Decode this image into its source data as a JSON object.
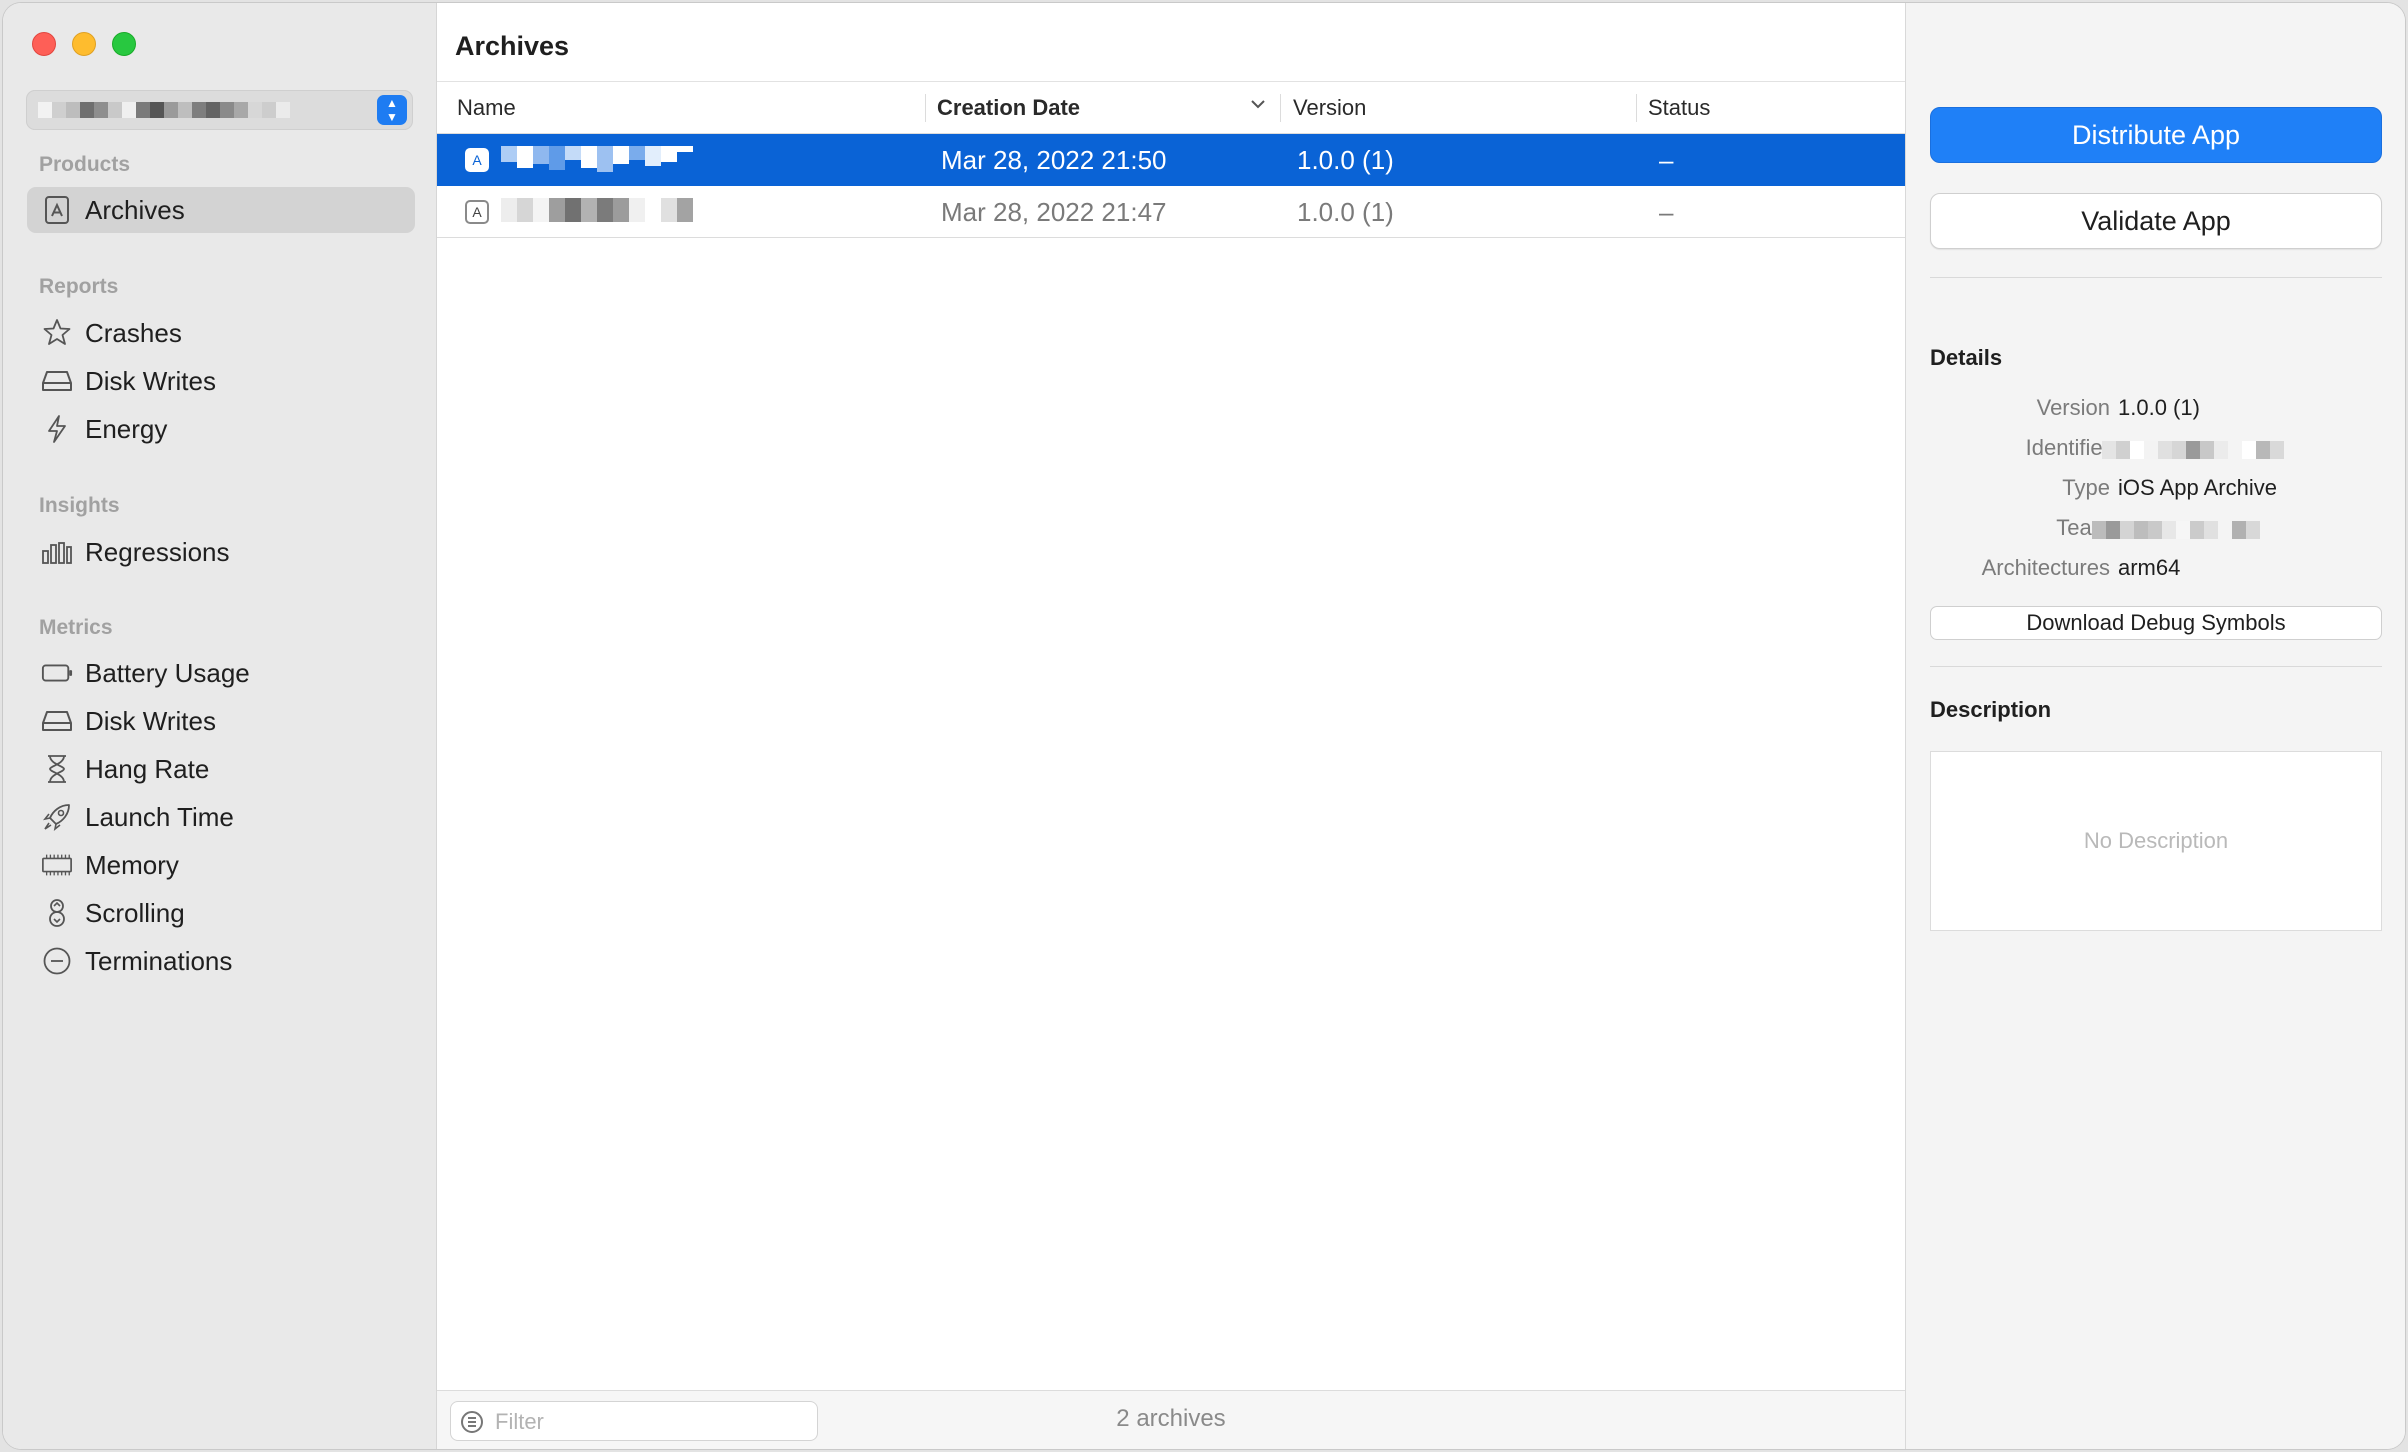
{
  "sidebar": {
    "app_picker": {
      "name": ""
    },
    "sections": {
      "products": "Products",
      "reports": "Reports",
      "insights": "Insights",
      "metrics": "Metrics"
    },
    "items": {
      "archives": "Archives",
      "crashes": "Crashes",
      "disk_writes_report": "Disk Writes",
      "energy": "Energy",
      "regressions": "Regressions",
      "battery_usage": "Battery Usage",
      "disk_writes_metric": "Disk Writes",
      "hang_rate": "Hang Rate",
      "launch_time": "Launch Time",
      "memory": "Memory",
      "scrolling": "Scrolling",
      "terminations": "Terminations"
    },
    "selected": "Archives"
  },
  "main": {
    "title": "Archives",
    "columns": [
      "Name",
      "Creation Date",
      "Version",
      "Status"
    ],
    "sorted_column": "Creation Date",
    "rows": [
      {
        "name": "",
        "date": "Mar 28, 2022 21:50",
        "version": "1.0.0 (1)",
        "status": "–",
        "selected": true
      },
      {
        "name": "",
        "date": "Mar 28, 2022 21:47",
        "version": "1.0.0 (1)",
        "status": "–",
        "selected": false
      }
    ],
    "filter": {
      "placeholder": "Filter",
      "value": ""
    },
    "count_text": "2 archives"
  },
  "inspector": {
    "distribute_label": "Distribute App",
    "validate_label": "Validate App",
    "details_heading": "Details",
    "details": {
      "version_label": "Version",
      "version_value": "1.0.0 (1)",
      "identifier_label": "Identifier",
      "identifier_value": "",
      "type_label": "Type",
      "type_value": "iOS App Archive",
      "team_label": "Team",
      "team_value": "",
      "architectures_label": "Architectures",
      "architectures_value": "arm64"
    },
    "download_symbols_label": "Download Debug Symbols",
    "description_heading": "Description",
    "description_placeholder": "No Description"
  },
  "colors": {
    "selection": "#0a63d6",
    "primary_button": "#1f80f7",
    "sidebar_bg": "#e9e9e9",
    "inspector_bg": "#f4f4f4"
  },
  "icons": {
    "archives": "archive-box-icon",
    "crashes": "star-burst-icon",
    "disk_writes": "drive-icon",
    "energy": "bolt-icon",
    "regressions": "bar-chart-icon",
    "battery_usage": "battery-icon",
    "hang_rate": "hourglass-icon",
    "launch_time": "rocket-icon",
    "memory": "memory-chip-icon",
    "scrolling": "scroll-gesture-icon",
    "terminations": "minus-circle-icon"
  }
}
